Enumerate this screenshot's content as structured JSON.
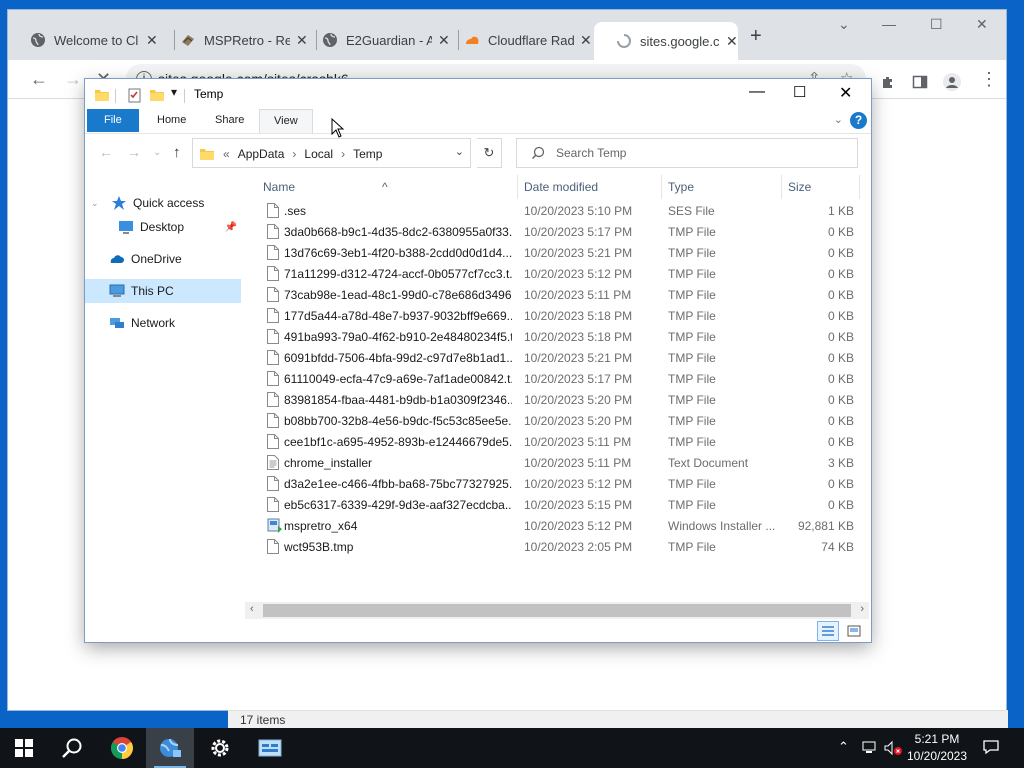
{
  "browser": {
    "tabs": [
      {
        "title": "Welcome to Cl",
        "icon": "globe-icon"
      },
      {
        "title": "MSPRetro - Re",
        "icon": "msp-retro-icon"
      },
      {
        "title": "E2Guardian - A",
        "icon": "globe-icon"
      },
      {
        "title": "Cloudflare Rad",
        "icon": "cloudflare-icon"
      },
      {
        "title": "sites.google.co",
        "icon": "loading-spinner-icon",
        "active": true
      }
    ],
    "url": "sites.google.com/sites/crashk6",
    "status_text": "17 items"
  },
  "explorer": {
    "window_title": "Temp",
    "ribbon_tabs": [
      "File",
      "Home",
      "Share",
      "View"
    ],
    "breadcrumb": [
      "AppData",
      "Local",
      "Temp"
    ],
    "search_placeholder": "Search Temp",
    "nav_items": [
      {
        "label": "Quick access",
        "icon": "star-icon"
      },
      {
        "label": "Desktop",
        "icon": "desktop-icon",
        "pinned": true
      },
      {
        "label": "OneDrive",
        "icon": "cloud-icon"
      },
      {
        "label": "This PC",
        "icon": "computer-icon",
        "selected": true
      },
      {
        "label": "Network",
        "icon": "network-icon"
      }
    ],
    "columns": [
      "Name",
      "Date modified",
      "Type",
      "Size"
    ],
    "files": [
      {
        "name": ".ses",
        "date": "10/20/2023 5:10 PM",
        "type": "SES File",
        "size": "1 KB",
        "icon": "file-icon"
      },
      {
        "name": "3da0b668-b9c1-4d35-8dc2-6380955a0f33...",
        "date": "10/20/2023 5:17 PM",
        "type": "TMP File",
        "size": "0 KB",
        "icon": "file-icon"
      },
      {
        "name": "13d76c69-3eb1-4f20-b388-2cdd0d0d1d4...",
        "date": "10/20/2023 5:21 PM",
        "type": "TMP File",
        "size": "0 KB",
        "icon": "file-icon"
      },
      {
        "name": "71a11299-d312-4724-accf-0b0577cf7cc3.t...",
        "date": "10/20/2023 5:12 PM",
        "type": "TMP File",
        "size": "0 KB",
        "icon": "file-icon"
      },
      {
        "name": "73cab98e-1ead-48c1-99d0-c78e686d3496...",
        "date": "10/20/2023 5:11 PM",
        "type": "TMP File",
        "size": "0 KB",
        "icon": "file-icon"
      },
      {
        "name": "177d5a44-a78d-48e7-b937-9032bff9e669...",
        "date": "10/20/2023 5:18 PM",
        "type": "TMP File",
        "size": "0 KB",
        "icon": "file-icon"
      },
      {
        "name": "491ba993-79a0-4f62-b910-2e48480234f5.t...",
        "date": "10/20/2023 5:18 PM",
        "type": "TMP File",
        "size": "0 KB",
        "icon": "file-icon"
      },
      {
        "name": "6091bfdd-7506-4bfa-99d2-c97d7e8b1ad1...",
        "date": "10/20/2023 5:21 PM",
        "type": "TMP File",
        "size": "0 KB",
        "icon": "file-icon"
      },
      {
        "name": "61110049-ecfa-47c9-a69e-7af1ade00842.t...",
        "date": "10/20/2023 5:17 PM",
        "type": "TMP File",
        "size": "0 KB",
        "icon": "file-icon"
      },
      {
        "name": "83981854-fbaa-4481-b9db-b1a0309f2346...",
        "date": "10/20/2023 5:20 PM",
        "type": "TMP File",
        "size": "0 KB",
        "icon": "file-icon"
      },
      {
        "name": "b08bb700-32b8-4e56-b9dc-f5c53c85ee5e...",
        "date": "10/20/2023 5:20 PM",
        "type": "TMP File",
        "size": "0 KB",
        "icon": "file-icon"
      },
      {
        "name": "cee1bf1c-a695-4952-893b-e12446679de5...",
        "date": "10/20/2023 5:11 PM",
        "type": "TMP File",
        "size": "0 KB",
        "icon": "file-icon"
      },
      {
        "name": "chrome_installer",
        "date": "10/20/2023 5:11 PM",
        "type": "Text Document",
        "size": "3 KB",
        "icon": "text-document-icon"
      },
      {
        "name": "d3a2e1ee-c466-4fbb-ba68-75bc77327925...",
        "date": "10/20/2023 5:12 PM",
        "type": "TMP File",
        "size": "0 KB",
        "icon": "file-icon"
      },
      {
        "name": "eb5c6317-6339-429f-9d3e-aaf327ecdcba...",
        "date": "10/20/2023 5:15 PM",
        "type": "TMP File",
        "size": "0 KB",
        "icon": "file-icon"
      },
      {
        "name": "mspretro_x64",
        "date": "10/20/2023 5:12 PM",
        "type": "Windows Installer ...",
        "size": "92,881 KB",
        "icon": "installer-icon"
      },
      {
        "name": "wct953B.tmp",
        "date": "10/20/2023 2:05 PM",
        "type": "TMP File",
        "size": "74 KB",
        "icon": "file-icon"
      }
    ]
  },
  "taskbar": {
    "apps": [
      "start-icon",
      "search-icon",
      "chrome-icon",
      "network-config-icon",
      "settings-icon",
      "server-manager-icon"
    ],
    "time": "5:21 PM",
    "date": "10/20/2023"
  },
  "colors": {
    "accent": "#1979ca",
    "selection": "#cce8ff",
    "desktop": "#0a64c8",
    "taskbar": "#101418"
  }
}
